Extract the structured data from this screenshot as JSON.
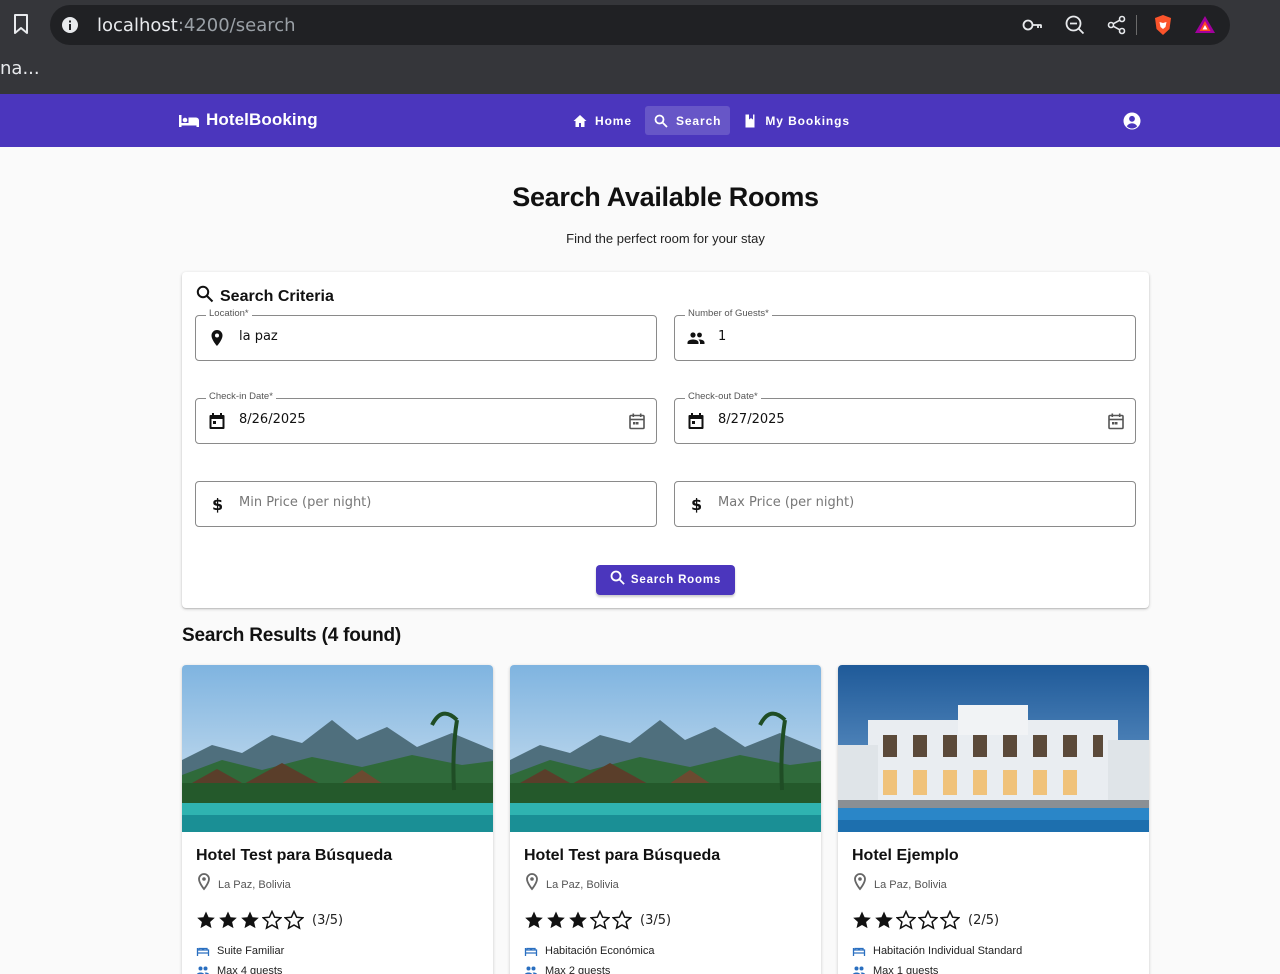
{
  "browser": {
    "url_host": "localhost",
    "url_path": ":4200/search",
    "tab_text": "na..."
  },
  "toolbar": {
    "brand": "HotelBooking",
    "nav": [
      {
        "label": "Home",
        "icon": "home-icon",
        "active": false
      },
      {
        "label": "Search",
        "icon": "search-icon",
        "active": true
      },
      {
        "label": "My Bookings",
        "icon": "bookmark-icon",
        "active": false
      }
    ],
    "accent_color": "#4b36bd"
  },
  "page": {
    "title": "Search Available Rooms",
    "subtitle": "Find the perfect room for your stay"
  },
  "search": {
    "title": "Search Criteria",
    "location": {
      "label": "Location*",
      "value": "la paz"
    },
    "guests": {
      "label": "Number of Guests*",
      "value": "1"
    },
    "checkin": {
      "label": "Check-in Date*",
      "value": "8/26/2025"
    },
    "checkout": {
      "label": "Check-out Date*",
      "value": "8/27/2025"
    },
    "min_price": {
      "placeholder": "Min Price (per night)"
    },
    "max_price": {
      "placeholder": "Max Price (per night)"
    },
    "button": "Search Rooms"
  },
  "results": {
    "title": "Search Results (4 found)",
    "hotels": [
      {
        "name": "Hotel Test para Búsqueda",
        "location": "La Paz, Bolivia",
        "rating": 3,
        "rating_text": "(3/5)",
        "room_type": "Suite Familiar",
        "guests": "Max 4 guests",
        "image": "tropical-resort"
      },
      {
        "name": "Hotel Test para Búsqueda",
        "location": "La Paz, Bolivia",
        "rating": 3,
        "rating_text": "(3/5)",
        "room_type": "Habitación Económica",
        "guests": "Max 2 guests",
        "image": "tropical-resort"
      },
      {
        "name": "Hotel Ejemplo",
        "location": "La Paz, Bolivia",
        "rating": 2,
        "rating_text": "(2/5)",
        "room_type": "Habitación Individual Standard",
        "guests": "Max 1 guests",
        "image": "white-hotel-pool"
      }
    ]
  }
}
